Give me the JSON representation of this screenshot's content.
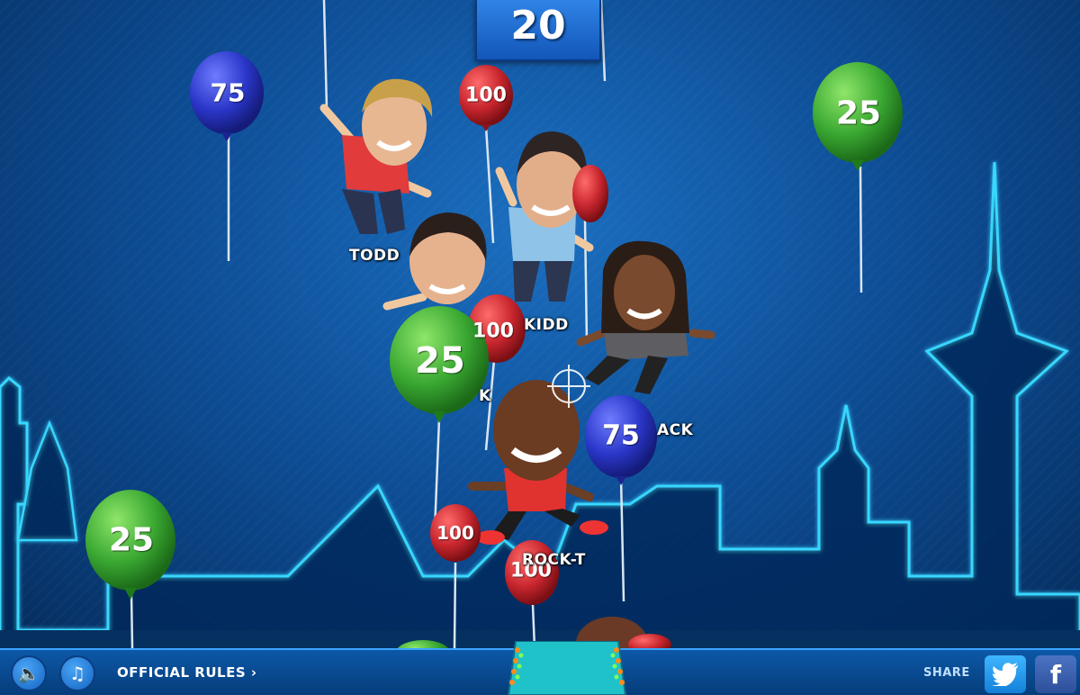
{
  "timer": "20",
  "balloons": [
    {
      "value": "75",
      "color": "blue"
    },
    {
      "value": "100",
      "color": "red"
    },
    {
      "value": "25",
      "color": "green"
    },
    {
      "value": "100",
      "color": "red"
    },
    {
      "value": "25",
      "color": "green"
    },
    {
      "value": "75",
      "color": "blue"
    },
    {
      "value": "25",
      "color": "green"
    },
    {
      "value": "100",
      "color": "red"
    },
    {
      "value": "100",
      "color": "red"
    }
  ],
  "characters": [
    "TODD",
    "KIDD",
    "ACK",
    "ROCK-T",
    "K"
  ],
  "colors": {
    "blue": "#2a36c8",
    "red": "#c8262e",
    "green": "#3aa832",
    "neon": "#39d6ff"
  },
  "footer": {
    "sound_icon": "speaker-icon",
    "music_icon": "music-note-icon",
    "rules_label": "OFFICIAL RULES ›",
    "share_label": "SHARE",
    "twitter_icon": "twitter-icon",
    "facebook_icon": "facebook-icon",
    "facebook_glyph": "f"
  }
}
